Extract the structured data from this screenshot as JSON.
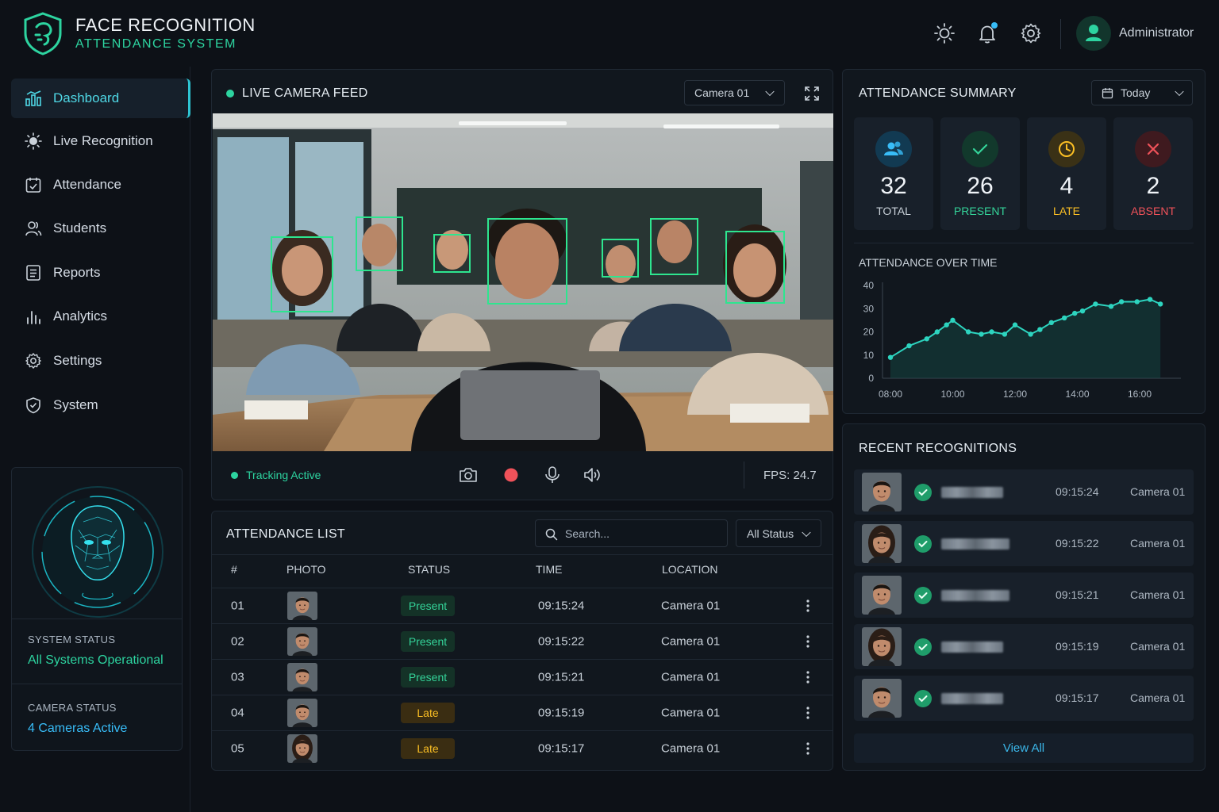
{
  "app": {
    "title_line1": "FACE RECOGNITION",
    "title_line2": "ATTENDANCE SYSTEM",
    "user": "Administrator"
  },
  "colors": {
    "accent": "#2dd4a0",
    "cyan": "#4fd8e6",
    "present": "#34d399",
    "late": "#fbbf24",
    "absent": "#f0525a",
    "total": "#38bdf8"
  },
  "sidebar": {
    "items": [
      {
        "label": "Dashboard",
        "icon": "dashboard-icon",
        "active": true
      },
      {
        "label": "Live Recognition",
        "icon": "sun-icon"
      },
      {
        "label": "Attendance",
        "icon": "calendar-check-icon"
      },
      {
        "label": "Students",
        "icon": "users-icon"
      },
      {
        "label": "Reports",
        "icon": "document-icon"
      },
      {
        "label": "Analytics",
        "icon": "bar-chart-icon"
      },
      {
        "label": "Settings",
        "icon": "gear-icon"
      },
      {
        "label": "System",
        "icon": "shield-check-icon"
      }
    ],
    "system_status_label": "SYSTEM STATUS",
    "system_status_value": "All Systems Operational",
    "camera_status_label": "CAMERA STATUS",
    "camera_status_value": "4 Cameras Active"
  },
  "feed": {
    "title": "LIVE CAMERA FEED",
    "camera": "Camera 01",
    "tracking": "Tracking Active",
    "fps": "FPS: 24.7"
  },
  "summary": {
    "title": "ATTENDANCE SUMMARY",
    "range": "Today",
    "stats": [
      {
        "value": "32",
        "label": "TOTAL"
      },
      {
        "value": "26",
        "label": "PRESENT"
      },
      {
        "value": "4",
        "label": "LATE"
      },
      {
        "value": "2",
        "label": "ABSENT"
      }
    ]
  },
  "chart_data": {
    "type": "line",
    "title": "ATTENDANCE OVER TIME",
    "x_ticks": [
      "08:00",
      "10:00",
      "12:00",
      "14:00",
      "16:00"
    ],
    "y_ticks": [
      "0",
      "10",
      "20",
      "30",
      "40"
    ],
    "ylim": [
      0,
      40
    ],
    "x": [
      "08:00",
      "08:36",
      "09:10",
      "09:30",
      "09:48",
      "10:00",
      "10:30",
      "10:55",
      "11:15",
      "11:40",
      "12:00",
      "12:30",
      "12:48",
      "13:10",
      "13:35",
      "13:55",
      "14:10",
      "14:35",
      "15:05",
      "15:25",
      "15:55",
      "16:20",
      "16:40"
    ],
    "values": [
      9,
      14,
      17,
      20,
      23,
      25,
      20,
      19,
      20,
      19,
      23,
      19,
      21,
      24,
      26,
      28,
      29,
      32,
      31,
      33,
      33,
      34,
      32
    ],
    "grid": false,
    "fill": true
  },
  "attendance_list": {
    "title": "ATTENDANCE LIST",
    "search_placeholder": "Search...",
    "filter": "All Status",
    "columns": [
      "#",
      "PHOTO",
      "STATUS",
      "TIME",
      "LOCATION"
    ],
    "rows": [
      {
        "num": "01",
        "status": "Present",
        "time": "09:15:24",
        "location": "Camera 01"
      },
      {
        "num": "02",
        "status": "Present",
        "time": "09:15:22",
        "location": "Camera 01"
      },
      {
        "num": "03",
        "status": "Present",
        "time": "09:15:21",
        "location": "Camera 01"
      },
      {
        "num": "04",
        "status": "Late",
        "time": "09:15:19",
        "location": "Camera 01"
      },
      {
        "num": "05",
        "status": "Late",
        "time": "09:15:17",
        "location": "Camera 01"
      }
    ]
  },
  "recent": {
    "title": "RECENT RECOGNITIONS",
    "view_all": "View All",
    "items": [
      {
        "time": "09:15:24",
        "camera": "Camera 01"
      },
      {
        "time": "09:15:22",
        "camera": "Camera 01"
      },
      {
        "time": "09:15:21",
        "camera": "Camera 01"
      },
      {
        "time": "09:15:19",
        "camera": "Camera 01"
      },
      {
        "time": "09:15:17",
        "camera": "Camera 01"
      }
    ]
  }
}
